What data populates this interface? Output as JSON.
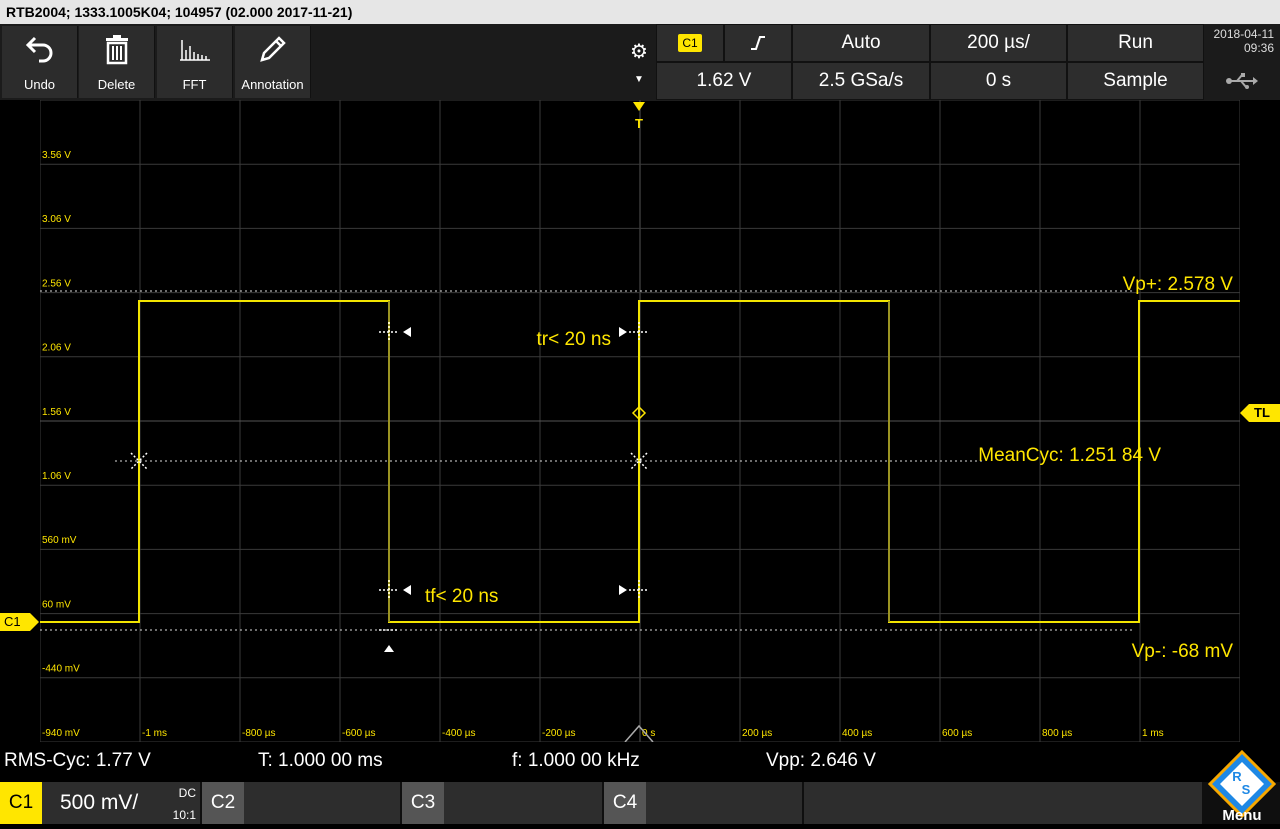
{
  "titlebar": {
    "text": "RTB2004; 1333.1005K04; 104957 (02.000 2017-11-21)"
  },
  "toolbar": {
    "undo": "Undo",
    "delete": "Delete",
    "fft": "FFT",
    "annotation": "Annotation"
  },
  "status": {
    "channel": "C1",
    "trigger_level": "1.62 V",
    "mode": "Auto",
    "sample_rate": "2.5 GSa/s",
    "timebase": "200 µs/",
    "position": "0 s",
    "run": "Run",
    "acq": "Sample",
    "date": "2018-04-11",
    "time": "09:36"
  },
  "colors": {
    "trace": "#f2e400",
    "accent": "#ffe600",
    "grid": "#3a3a3a"
  },
  "screen": {
    "y_labels": [
      "3.56 V",
      "3.06 V",
      "2.56 V",
      "2.06 V",
      "1.56 V",
      "1.06 V",
      "560 mV",
      "60 mV",
      "-440 mV",
      "-940 mV"
    ],
    "x_labels": [
      "-1 ms",
      "-800 µs",
      "-600 µs",
      "-400 µs",
      "-200 µs",
      "0 s",
      "200 µs",
      "400 µs",
      "600 µs",
      "800 µs",
      "1 ms"
    ],
    "annotations": {
      "vp_plus": "Vp+: 2.578 V",
      "vp_minus": "Vp-: -68 mV",
      "mean": "MeanCyc: 1.251 84 V",
      "tr": "tr< 20 ns",
      "tf": "tf< 20 ns"
    },
    "markers": {
      "ch": "C1",
      "tl": "TL",
      "trig": "T"
    }
  },
  "measurements": {
    "rms": "RMS-Cyc: 1.77 V",
    "period": "T: 1.000 00 ms",
    "freq": "f: 1.000 00 kHz",
    "vpp": "Vpp: 2.646 V"
  },
  "channels": {
    "c1": {
      "label": "C1",
      "scale": "500 mV/",
      "coupling": "DC",
      "probe": "10:1"
    },
    "c2": {
      "label": "C2"
    },
    "c3": {
      "label": "C3"
    },
    "c4": {
      "label": "C4"
    }
  },
  "menu": {
    "label": "Menu"
  }
}
